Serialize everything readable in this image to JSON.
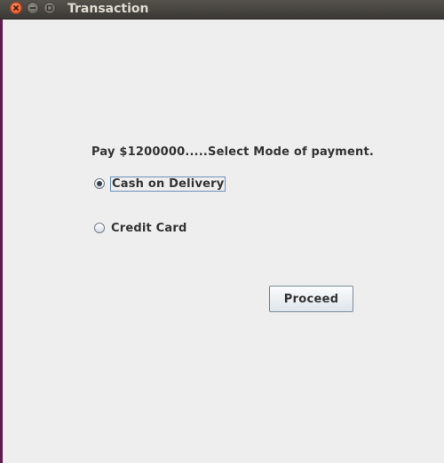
{
  "window": {
    "title": "Transaction"
  },
  "prompt": "Pay $1200000.....Select Mode of payment.",
  "payment_options": [
    {
      "label": "Cash on Delivery",
      "selected": true
    },
    {
      "label": "Credit Card",
      "selected": false
    }
  ],
  "proceed_label": "Proceed"
}
